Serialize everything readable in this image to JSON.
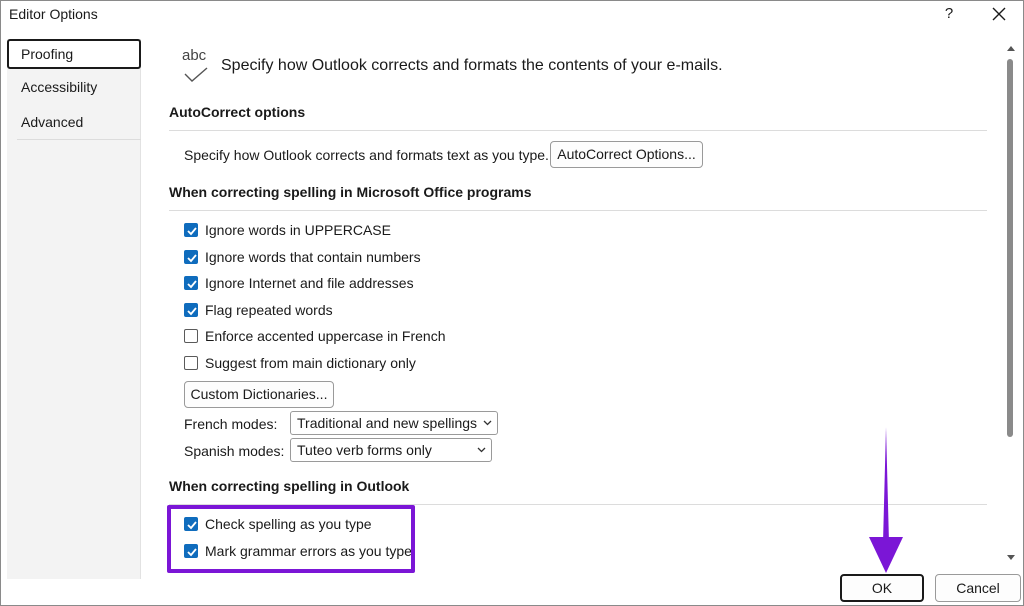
{
  "window": {
    "title": "Editor Options",
    "help_label": "?"
  },
  "nav": {
    "items": [
      "Proofing",
      "Accessibility",
      "Advanced"
    ],
    "selected": "Proofing"
  },
  "header": {
    "icon_text": "abc",
    "description": "Specify how Outlook corrects and formats the contents of your e-mails."
  },
  "autocorrect": {
    "title": "AutoCorrect options",
    "description": "Specify how Outlook corrects and formats text as you type.",
    "button_label": "AutoCorrect Options..."
  },
  "office_spelling": {
    "title": "When correcting spelling in Microsoft Office programs",
    "options": [
      {
        "label": "Ignore words in UPPERCASE",
        "checked": true
      },
      {
        "label": "Ignore words that contain numbers",
        "checked": true
      },
      {
        "label": "Ignore Internet and file addresses",
        "checked": true
      },
      {
        "label": "Flag repeated words",
        "checked": true
      },
      {
        "label": "Enforce accented uppercase in French",
        "checked": false
      },
      {
        "label": "Suggest from main dictionary only",
        "checked": false
      }
    ],
    "custom_dictionaries_label": "Custom Dictionaries...",
    "french_modes_label": "French modes:",
    "french_modes_value": "Traditional and new spellings",
    "spanish_modes_label": "Spanish modes:",
    "spanish_modes_value": "Tuteo verb forms only"
  },
  "outlook_spelling": {
    "title": "When correcting spelling in Outlook",
    "options": [
      {
        "label": "Check spelling as you type",
        "checked": true
      },
      {
        "label": "Mark grammar errors as you type",
        "checked": true
      }
    ]
  },
  "footer": {
    "ok_label": "OK",
    "cancel_label": "Cancel"
  },
  "colors": {
    "accent": "#0f6cbd",
    "highlight": "#7b16d6"
  },
  "icons": [
    "close-icon",
    "abc-check-icon",
    "checkbox-check-icon",
    "chevron-down-icon",
    "scroll-up-icon",
    "scroll-down-icon"
  ]
}
